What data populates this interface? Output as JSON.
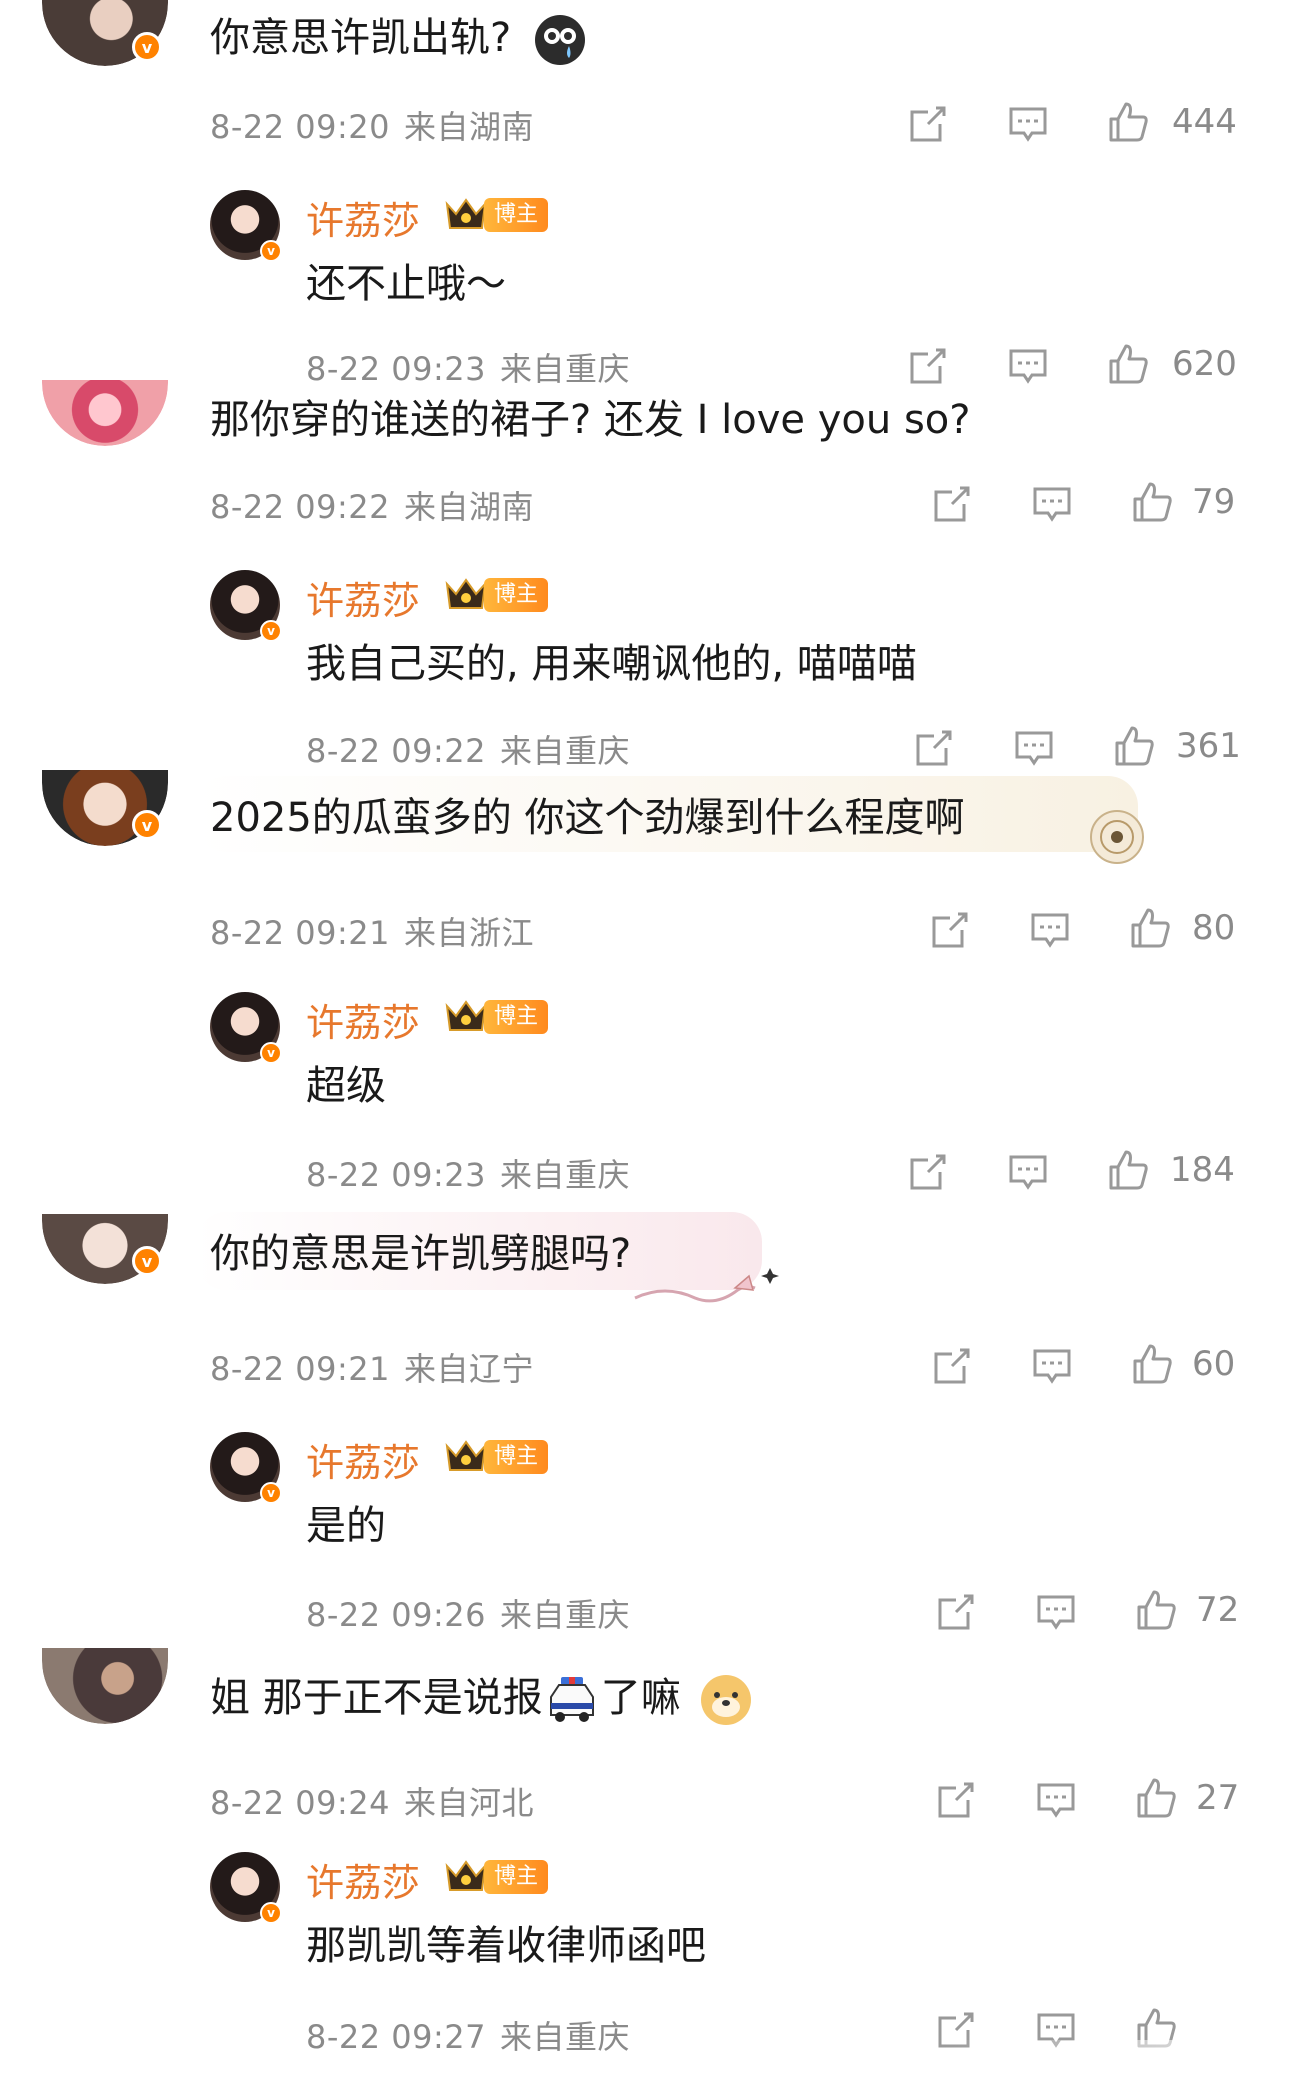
{
  "blogger": {
    "name": "许荔莎",
    "tag": "博主"
  },
  "icon_names": [
    "share-icon",
    "comment-icon",
    "like-icon"
  ],
  "threads": [
    {
      "comment": {
        "text": "你意思许凯出轨?",
        "time": "8-22 09:20",
        "location": "来自湖南",
        "likes": "444"
      },
      "reply": {
        "text": "还不止哦～",
        "time": "8-22 09:23",
        "location": "来自重庆",
        "likes": "620"
      }
    },
    {
      "comment": {
        "text": "那你穿的谁送的裙子? 还发 I love you so?",
        "time": "8-22 09:22",
        "location": "来自湖南",
        "likes": "79"
      },
      "reply": {
        "text": "我自己买的, 用来嘲讽他的, 喵喵喵",
        "time": "8-22 09:22",
        "location": "来自重庆",
        "likes": "361"
      }
    },
    {
      "comment": {
        "text": "2025的瓜蛮多的 你这个劲爆到什么程度啊",
        "time": "8-22 09:21",
        "location": "来自浙江",
        "likes": "80"
      },
      "reply": {
        "text": "超级",
        "time": "8-22 09:23",
        "location": "来自重庆",
        "likes": "184"
      }
    },
    {
      "comment": {
        "text": "你的意思是许凯劈腿吗?",
        "time": "8-22 09:21",
        "location": "来自辽宁",
        "likes": "60"
      },
      "reply": {
        "text": "是的",
        "time": "8-22 09:26",
        "location": "来自重庆",
        "likes": "72"
      }
    },
    {
      "comment": {
        "text_before": "姐 那于正不是说报",
        "text_after": "了嘛",
        "time": "8-22 09:24",
        "location": "来自河北",
        "likes": "27"
      },
      "reply": {
        "text": "那凯凯等着收律师函吧",
        "time": "8-22 09:27",
        "location": "来自重庆",
        "likes": ""
      }
    }
  ]
}
